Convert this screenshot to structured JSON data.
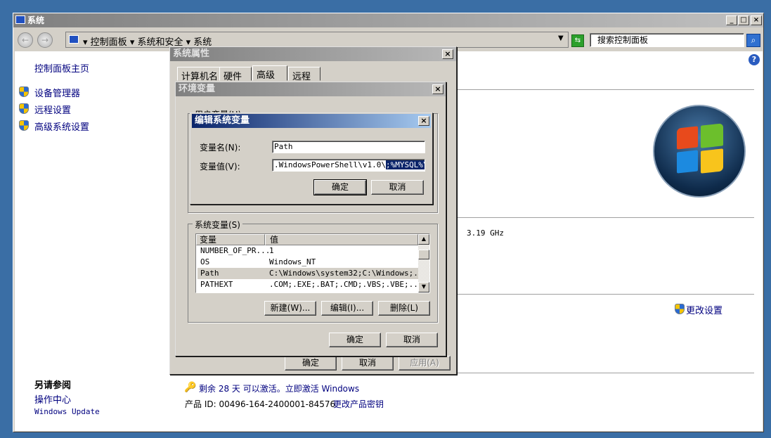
{
  "window": {
    "title": "系统",
    "min": "_",
    "max": "□",
    "close": "×"
  },
  "address": {
    "crumbs": [
      "控制面板",
      "系统和安全",
      "系统"
    ],
    "search_placeholder": "搜索控制面板"
  },
  "sidebar": {
    "home": "控制面板主页",
    "items": [
      {
        "label": "设备管理器"
      },
      {
        "label": "远程设置"
      },
      {
        "label": "高级系统设置"
      }
    ],
    "see_also": "另请参阅",
    "links": [
      "操作中心",
      "Windows Update"
    ]
  },
  "main": {
    "cpu": "3.19 GHz",
    "change_settings": "更改设置",
    "activation": "剩余 28 天 可以激活。立即激活 Windows",
    "product_id": "产品 ID: 00496-164-2400001-84576",
    "change_key": "更改产品密钥"
  },
  "sysprops": {
    "title": "系统属性",
    "tabs": [
      "计算机名",
      "硬件",
      "高级",
      "远程"
    ],
    "active_tab": "高级",
    "ok": "确定",
    "cancel": "取消",
    "apply": "应用(A)"
  },
  "envvars": {
    "title": "环境变量",
    "user_group": "用户变量(U)",
    "sys_group": "系统变量(S)",
    "columns": [
      "变量",
      "值"
    ],
    "rows": [
      {
        "name": "NUMBER_OF_PR...",
        "value": "1"
      },
      {
        "name": "OS",
        "value": "Windows_NT"
      },
      {
        "name": "Path",
        "value": "C:\\Windows\\system32;C:\\Windows;..."
      },
      {
        "name": "PATHEXT",
        "value": ".COM;.EXE;.BAT;.CMD;.VBS;.VBE;...."
      }
    ],
    "selected_row": "Path",
    "new": "新建(W)...",
    "edit": "编辑(I)...",
    "delete": "删除(L)",
    "ok": "确定",
    "cancel": "取消"
  },
  "editvar": {
    "title": "编辑系统变量",
    "name_label": "变量名(N):",
    "value_label": "变量值(V):",
    "name_value": "Path",
    "value_prefix": ".WindowsPowerShell\\v1.0\\",
    "value_selected": ";%MYSQL%\\bin",
    "ok": "确定",
    "cancel": "取消"
  }
}
